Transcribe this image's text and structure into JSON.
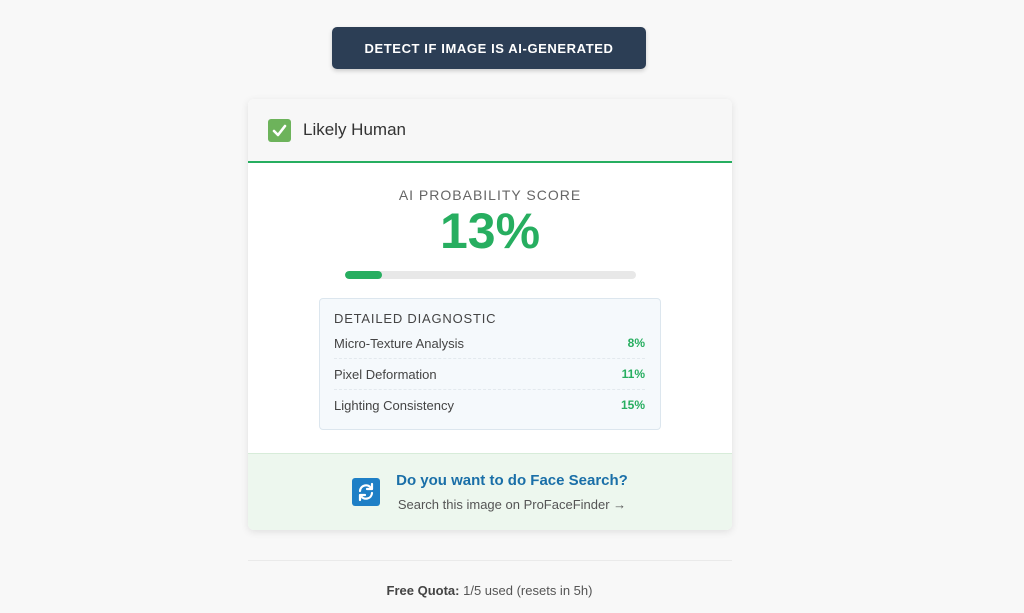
{
  "detect_button": {
    "label": "DETECT IF IMAGE IS AI-GENERATED"
  },
  "result": {
    "verdict": "Likely Human",
    "verdict_icon": "check-icon",
    "score_label": "AI PROBABILITY SCORE",
    "score_value": "13%",
    "score_fraction": 0.13,
    "accent_color": "#27ae60"
  },
  "diagnostic": {
    "title": "DETAILED DIAGNOSTIC",
    "rows": [
      {
        "label": "Micro-Texture Analysis",
        "value": "8%"
      },
      {
        "label": "Pixel Deformation",
        "value": "11%"
      },
      {
        "label": "Lighting Consistency",
        "value": "15%"
      }
    ]
  },
  "face_search": {
    "icon": "refresh-icon",
    "title": "Do you want to do Face Search?",
    "subtitle": "Search this image on ProFaceFinder →"
  },
  "quota": {
    "label": "Free Quota:",
    "value": "1/5 used (resets in 5h)"
  }
}
